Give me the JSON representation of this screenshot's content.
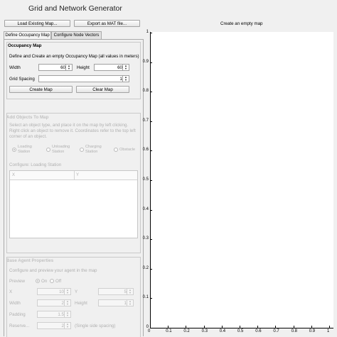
{
  "window": {
    "title": "Grid and Network Generator"
  },
  "toolbar": {
    "load_label": "Load Existing Map...",
    "export_label": "Export as MAT file...",
    "status": "Create an empty map"
  },
  "tabs": [
    {
      "label": "Define Occupancy Map",
      "active": true
    },
    {
      "label": "Configure Node Vectors",
      "active": false
    }
  ],
  "occupancy": {
    "header": "Occupancy Map",
    "description": "Define and Create an empty Occupancy Map (all values in meters)",
    "width_label": "Width",
    "width_value": "60",
    "height_label": "Height",
    "height_value": "60",
    "spacing_label": "Grid Spacing",
    "spacing_value": "1",
    "create_label": "Create Map",
    "clear_label": "Clear Map"
  },
  "objects": {
    "header": "Add Objects To Map",
    "description": "Select an object type, and place it on the map by left clicking. Right click an object to remove it. Coordinates refer to the top left corner of an object.",
    "options": [
      "Loading Station",
      "Unloading Station",
      "Charging Station",
      "Obstacle"
    ],
    "selected": "Loading Station",
    "configure_label": "Configure: Loading Station",
    "columns": [
      "X",
      "Y"
    ]
  },
  "agent": {
    "header": "Base Agent Properties",
    "description": "Configure and preview your agent in the map",
    "preview_label": "Preview",
    "on_label": "On",
    "off_label": "Off",
    "x_label": "X",
    "x_value": "10",
    "y_label": "Y",
    "y_value": "5",
    "width_label": "Width",
    "width_value": "2",
    "height_label": "Height",
    "height_value": "1",
    "padding_label": "Padding",
    "padding_value": "1.5",
    "reserve_label": "Reserve...",
    "reserve_value": "2",
    "reserve_note": "(Single side spacing)"
  },
  "chart_data": {
    "type": "line",
    "title": "",
    "xlabel": "",
    "ylabel": "",
    "xlim": [
      0,
      1
    ],
    "ylim": [
      0,
      1
    ],
    "xticks": [
      "0",
      "0.1",
      "0.2",
      "0.3",
      "0.4",
      "0.5",
      "0.6",
      "0.7",
      "0.8",
      "0.9",
      "1"
    ],
    "yticks": [
      "0",
      "0.1",
      "0.2",
      "0.3",
      "0.4",
      "0.5",
      "0.6",
      "0.7",
      "0.8",
      "0.9",
      "1"
    ],
    "series": []
  }
}
